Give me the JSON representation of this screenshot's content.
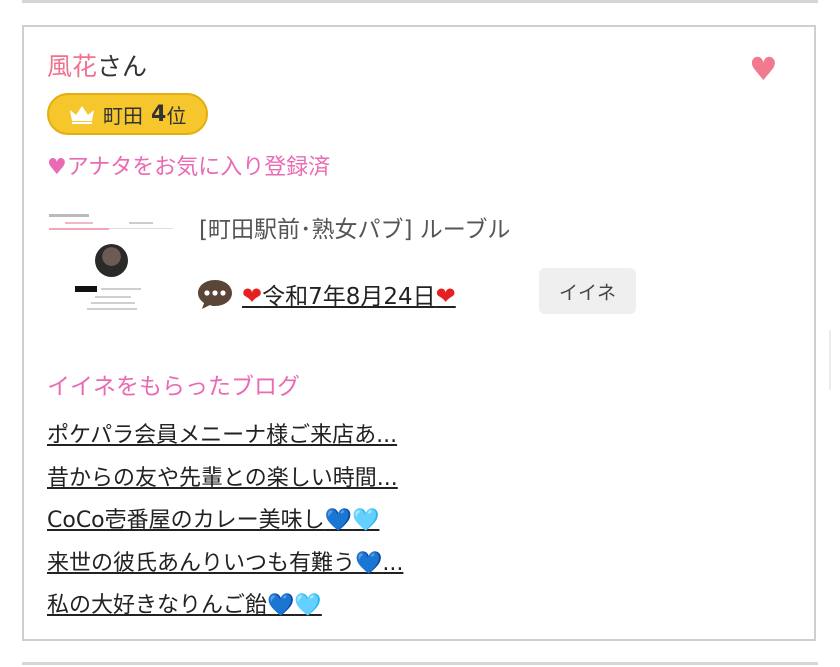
{
  "profile": {
    "name": "風花",
    "honorific": "さん",
    "favorite_icon": "heart-icon",
    "rank": {
      "icon": "crown-icon",
      "area": "町田",
      "number": "4",
      "unit": "位"
    },
    "favorite_status": "♥アナタをお気に入り登録済"
  },
  "shop": {
    "name": "[町田駅前･熟女パブ]  ルーブル"
  },
  "diary": {
    "icon": "speech-bubble-icon",
    "heart_left": "❤",
    "date": "令和7年8月24日",
    "heart_right": "❤",
    "like_button": "イイネ"
  },
  "blog": {
    "heading": "イイネをもらったブログ",
    "items": [
      {
        "text": "ポケパラ会員メニーナ様ご来店あ...",
        "emoji": []
      },
      {
        "text": "昔からの友や先輩との楽しい時間...",
        "emoji": []
      },
      {
        "text": "CoCo壱番屋のカレー美味し",
        "emoji": [
          "💙",
          "🩵"
        ]
      },
      {
        "text": "来世の彼氏あんりいつも有難う",
        "emoji": [
          "💙"
        ],
        "suffix": "..."
      },
      {
        "text": "私の大好きなりんご飴",
        "emoji": [
          "💙",
          "🩵"
        ]
      }
    ]
  },
  "colors": {
    "name_pink": "#f0728f",
    "accent_pink": "#ea6ab4",
    "rank_gold": "#f6c62d",
    "heart_red": "#e62020",
    "border_gray": "#cfcfcf"
  }
}
